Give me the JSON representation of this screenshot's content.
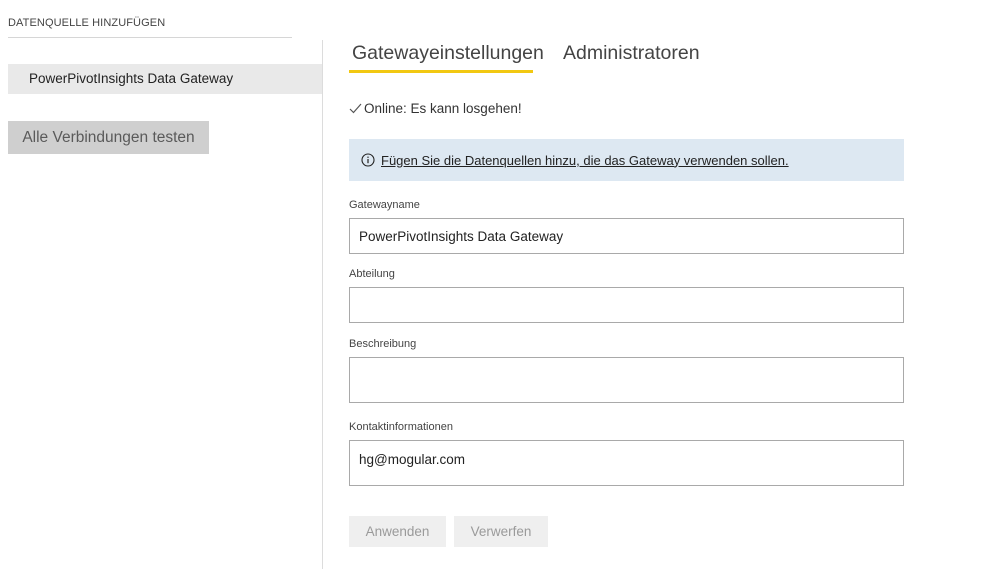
{
  "sidebar": {
    "add_source_label": "DATENQUELLE HINZUFÜGEN",
    "gateway_item": "PowerPivotInsights Data Gateway",
    "test_all_button": "Alle Verbindungen testen"
  },
  "tabs": [
    {
      "label": "Gatewayeinstellungen",
      "active": true
    },
    {
      "label": "Administratoren",
      "active": false
    }
  ],
  "status": {
    "icon": "checkmark-icon",
    "text": "Online: Es kann losgehen!"
  },
  "banner": {
    "icon": "info-icon",
    "link_text": "Fügen Sie die Datenquellen hinzu, die das Gateway verwenden sollen.",
    "background": "#dde8f2"
  },
  "form": {
    "gateway_name": {
      "label": "Gatewayname",
      "value": "PowerPivotInsights Data Gateway"
    },
    "department": {
      "label": "Abteilung",
      "value": ""
    },
    "description": {
      "label": "Beschreibung",
      "value": ""
    },
    "contact": {
      "label": "Kontaktinformationen",
      "value": "hg@mogular.com"
    }
  },
  "buttons": {
    "apply": "Anwenden",
    "discard": "Verwerfen"
  },
  "colors": {
    "accent_tab_underline": "#f2c811",
    "selected_item_bg": "#e9e9e9"
  }
}
